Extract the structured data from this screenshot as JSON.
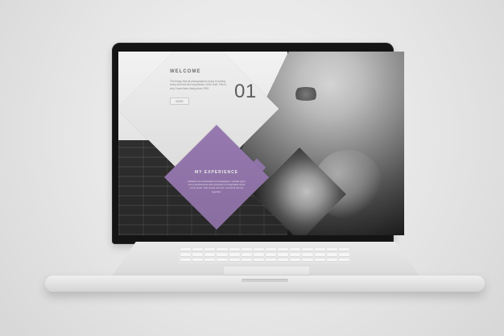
{
  "screen": {
    "welcome": {
      "title": "WELCOME",
      "number": "01",
      "button_label": "MORE",
      "body": "The things that all photographers enjoy is turning every shot into fine expression of the craft. This is why I have been doing since 2002."
    },
    "experience": {
      "title": "MY EXPERIENCE",
      "body": "Default is an enthusiast in photography. I quickly grew into a professional with hundreds of imaginable shots every week. Just create and turn moments into art together."
    }
  },
  "colors": {
    "accent_purple": "#9b7cb6",
    "light_panel": "#efefef",
    "dark_bg": "#1b1b1b"
  }
}
